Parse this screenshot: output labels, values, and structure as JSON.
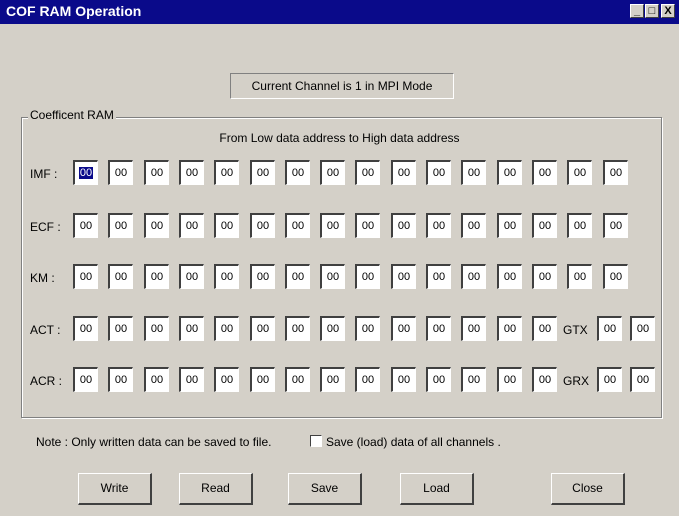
{
  "window": {
    "title": "COF RAM Operation",
    "minimize": "_",
    "maximize": "□",
    "close": "X"
  },
  "status": "Current Channel is 1 in MPI Mode",
  "group": {
    "label": "Coefficent RAM",
    "subtitle": "From Low data address to High data address"
  },
  "rows": [
    {
      "label": "IMF :",
      "values": [
        "00",
        "00",
        "00",
        "00",
        "00",
        "00",
        "00",
        "00",
        "00",
        "00",
        "00",
        "00",
        "00",
        "00",
        "00",
        "00"
      ]
    },
    {
      "label": "ECF :",
      "values": [
        "00",
        "00",
        "00",
        "00",
        "00",
        "00",
        "00",
        "00",
        "00",
        "00",
        "00",
        "00",
        "00",
        "00",
        "00",
        "00"
      ]
    },
    {
      "label": "KM :",
      "values": [
        "00",
        "00",
        "00",
        "00",
        "00",
        "00",
        "00",
        "00",
        "00",
        "00",
        "00",
        "00",
        "00",
        "00",
        "00",
        "00"
      ]
    },
    {
      "label": "ACT :",
      "values": [
        "00",
        "00",
        "00",
        "00",
        "00",
        "00",
        "00",
        "00",
        "00",
        "00",
        "00",
        "00",
        "00",
        "00"
      ],
      "extra_label": "GTX",
      "extra_values": [
        "00",
        "00"
      ]
    },
    {
      "label": "ACR :",
      "values": [
        "00",
        "00",
        "00",
        "00",
        "00",
        "00",
        "00",
        "00",
        "00",
        "00",
        "00",
        "00",
        "00",
        "00"
      ],
      "extra_label": "GRX",
      "extra_values": [
        "00",
        "00"
      ]
    }
  ],
  "note": "Note :  Only written data can be saved to file.",
  "save_all_checkbox": {
    "label": "Save (load) data of all channels .",
    "checked": false
  },
  "buttons": {
    "write": "Write",
    "read": "Read",
    "save": "Save",
    "load": "Load",
    "close": "Close"
  },
  "colors": {
    "title_bar": "#0a0a8a",
    "face": "#d4d0c8",
    "field": "#ffffff",
    "selection": "#0a0a8a"
  }
}
